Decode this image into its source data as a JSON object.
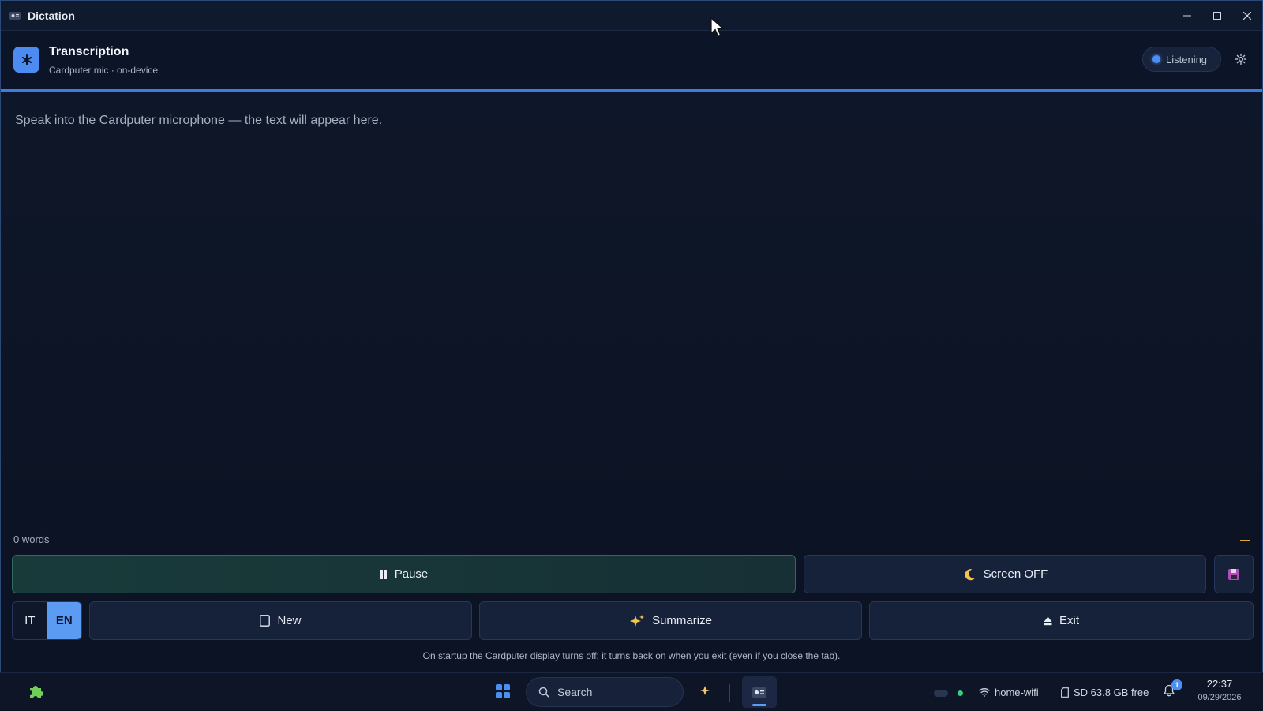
{
  "window": {
    "title": "Dictation"
  },
  "header": {
    "title": "Transcription",
    "subtitle": "Cardputer mic · on-device",
    "status": "Listening"
  },
  "transcript": {
    "placeholder": "Speak into the Cardputer microphone — the text will appear here.",
    "word_count": "0 words"
  },
  "controls": {
    "pause_label": "Pause",
    "screen_off_label": "Screen OFF",
    "lang_options": [
      "IT",
      "EN"
    ],
    "lang_selected": "EN",
    "new_label": "New",
    "summarize_label": "Summarize",
    "exit_label": "Exit"
  },
  "hint": "On startup the Cardputer display turns off; it turns back on when you exit (even if you close the tab).",
  "taskbar": {
    "search_placeholder": "Search",
    "wifi_name": "home-wifi",
    "sd_status": "SD 63.8 GB free",
    "notification_count": "1",
    "time": "22:37",
    "date": "09/29/2026"
  },
  "colors": {
    "accent": "#4c8cf0",
    "pause_bg": "#183b3a",
    "status_dot": "#4a8ff5",
    "online_dot": "#35d07f"
  },
  "icons": {
    "app": "dictation-app-icon",
    "logo": "asterisk-icon",
    "settings": "gear-icon",
    "pause": "pause-icon",
    "screen_off": "moon-icon",
    "save": "floppy-disk-icon",
    "new": "document-icon",
    "summarize": "sparkles-icon",
    "exit": "eject-icon"
  }
}
